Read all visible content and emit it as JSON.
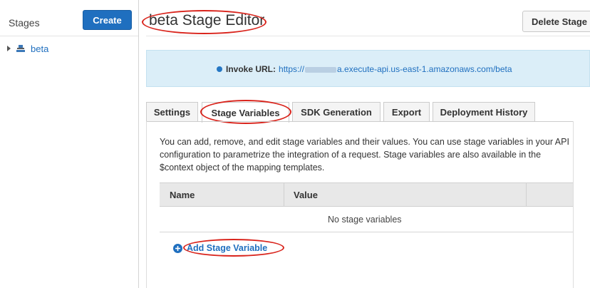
{
  "sidebar": {
    "title": "Stages",
    "create_label": "Create",
    "stages": [
      {
        "name": "beta"
      }
    ]
  },
  "header": {
    "title": "beta Stage Editor",
    "delete_label": "Delete Stage"
  },
  "invoke": {
    "label": "Invoke URL:",
    "url_prefix": "https://",
    "url_suffix": "a.execute-api.us-east-1.amazonaws.com/beta"
  },
  "tabs": [
    {
      "label": "Settings"
    },
    {
      "label": "Stage Variables",
      "active": true
    },
    {
      "label": "SDK Generation"
    },
    {
      "label": "Export"
    },
    {
      "label": "Deployment History"
    }
  ],
  "stage_variables": {
    "description": "You can add, remove, and edit stage variables and their values. You can use stage variables in your API configuration to parametrize the integration of a request. Stage variables are also available in the $context object of the mapping templates.",
    "columns": [
      "Name",
      "Value"
    ],
    "empty_text": "No stage variables",
    "add_label": "Add Stage Variable"
  },
  "colors": {
    "primary_blue": "#1f6fbf",
    "annotation_red": "#d9241c",
    "info_bg": "#dbeef8"
  }
}
